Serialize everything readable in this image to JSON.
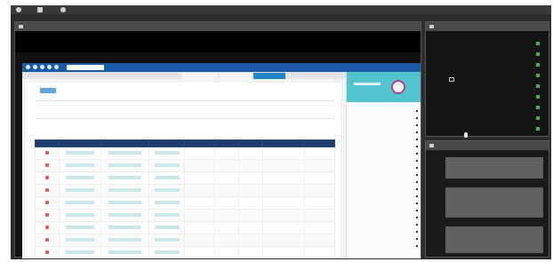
{
  "window": {
    "main_panel_title": "",
    "right_top_title": "",
    "right_bottom_title": ""
  },
  "inner_app": {
    "title": "",
    "tabs": [
      "",
      "",
      ""
    ],
    "heading": "",
    "subheading": "",
    "section_label": "",
    "table": {
      "columns": [
        "",
        "",
        "",
        "",
        "",
        "",
        "",
        "",
        ""
      ],
      "rows": [
        [
          "",
          "",
          "",
          "",
          "",
          "",
          "",
          "",
          ""
        ],
        [
          "",
          "",
          "",
          "",
          "",
          "",
          "",
          "",
          ""
        ],
        [
          "",
          "",
          "",
          "",
          "",
          "",
          "",
          "",
          ""
        ],
        [
          "",
          "",
          "",
          "",
          "",
          "",
          "",
          "",
          ""
        ],
        [
          "",
          "",
          "",
          "",
          "",
          "",
          "",
          "",
          ""
        ],
        [
          "",
          "",
          "",
          "",
          "",
          "",
          "",
          "",
          ""
        ],
        [
          "",
          "",
          "",
          "",
          "",
          "",
          "",
          "",
          ""
        ],
        [
          "",
          "",
          "",
          "",
          "",
          "",
          "",
          "",
          ""
        ],
        [
          "",
          "",
          "",
          "",
          "",
          "",
          "",
          "",
          ""
        ],
        [
          "",
          "",
          "",
          "",
          "",
          "",
          "",
          "",
          ""
        ]
      ]
    },
    "sidebar_items": [
      "",
      "",
      "",
      "",
      "",
      "",
      "",
      "",
      "",
      "",
      "",
      "",
      "",
      "",
      "",
      "",
      "",
      "",
      "",
      ""
    ]
  },
  "right_top_list": [
    "",
    "",
    "",
    "",
    "",
    "",
    "",
    "",
    ""
  ],
  "messages": [
    "",
    "",
    ""
  ],
  "colors": {
    "inner_header": "#1a5aa8",
    "table_header": "#1e3e6e",
    "logo_bg": "#51c4cf",
    "list_marker": "#4caf50"
  }
}
